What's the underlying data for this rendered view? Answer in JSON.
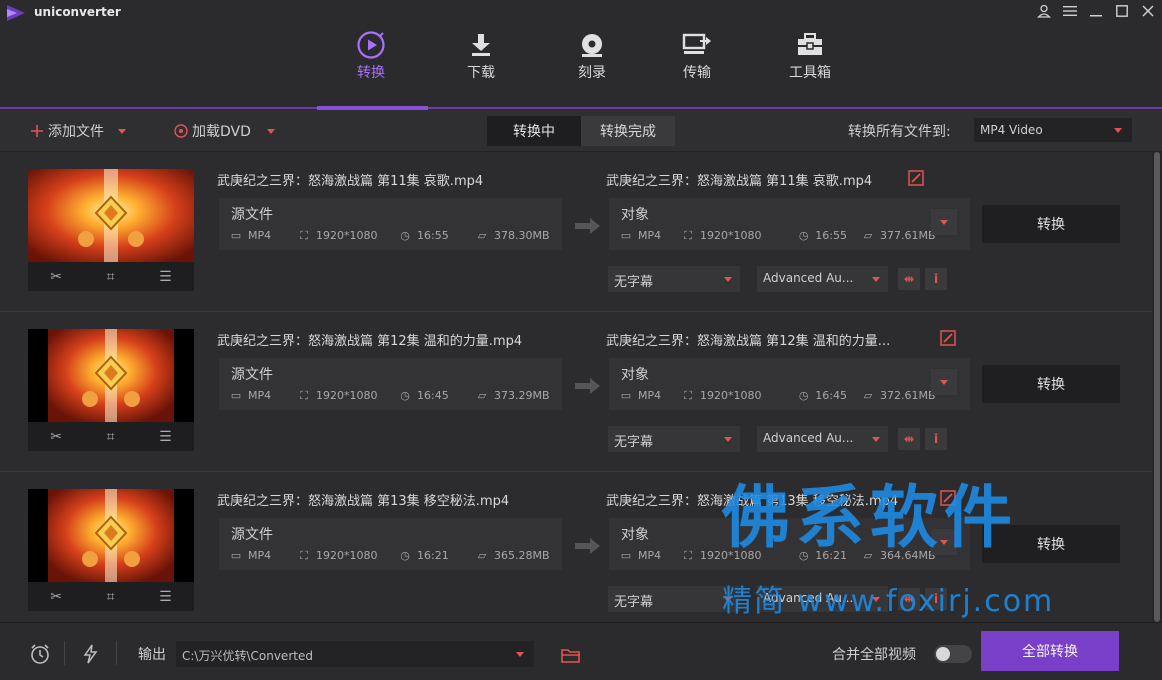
{
  "app": {
    "title": "uniconverter"
  },
  "nav": [
    {
      "label": "转换",
      "icon": "convert-icon",
      "active": true
    },
    {
      "label": "下载",
      "icon": "download-icon",
      "active": false
    },
    {
      "label": "刻录",
      "icon": "burn-disc-icon",
      "active": false
    },
    {
      "label": "传输",
      "icon": "transfer-icon",
      "active": false
    },
    {
      "label": "工具箱",
      "icon": "toolbox-icon",
      "active": false
    }
  ],
  "toolbar": {
    "add_files": "添加文件",
    "load_dvd": "加载DVD",
    "tab_converting": "转换中",
    "tab_finished": "转换完成",
    "convert_all_to_label": "转换所有文件到:",
    "format_value": "MP4 Video"
  },
  "files": [
    {
      "source_name": "武庚纪之三界：怒海激战篇 第11集 哀歌.mp4",
      "target_name": "武庚纪之三界：怒海激战篇 第11集 哀歌.mp4",
      "source_label": "源文件",
      "target_label": "对象",
      "src": {
        "format": "MP4",
        "resolution": "1920*1080",
        "duration": "16:55",
        "size": "378.30MB"
      },
      "dst": {
        "format": "MP4",
        "resolution": "1920*1080",
        "duration": "16:55",
        "size": "377.61MB"
      },
      "subtitle": "无字幕",
      "audio": "Advanced Au...",
      "convert_label": "转换"
    },
    {
      "source_name": "武庚纪之三界：怒海激战篇 第12集 温和的力量.mp4",
      "target_name": "武庚纪之三界：怒海激战篇 第12集 温和的力量...",
      "source_label": "源文件",
      "target_label": "对象",
      "src": {
        "format": "MP4",
        "resolution": "1920*1080",
        "duration": "16:45",
        "size": "373.29MB"
      },
      "dst": {
        "format": "MP4",
        "resolution": "1920*1080",
        "duration": "16:45",
        "size": "372.61MB"
      },
      "subtitle": "无字幕",
      "audio": "Advanced Au...",
      "convert_label": "转换"
    },
    {
      "source_name": "武庚纪之三界：怒海激战篇 第13集 移空秘法.mp4",
      "target_name": "武庚纪之三界：怒海激战篇 第13集 移空秘法.mp4",
      "source_label": "源文件",
      "target_label": "对象",
      "src": {
        "format": "MP4",
        "resolution": "1920*1080",
        "duration": "16:21",
        "size": "365.28MB"
      },
      "dst": {
        "format": "MP4",
        "resolution": "1920*1080",
        "duration": "16:21",
        "size": "364.64MB"
      },
      "subtitle": "无字幕",
      "audio": "Advanced Au...",
      "convert_label": "转换"
    }
  ],
  "bottom": {
    "output_label": "输出",
    "output_path": "C:\\万兴优转\\Converted",
    "merge_label": "合并全部视频",
    "convert_all": "全部转换"
  },
  "watermark": {
    "big": "佛系软件",
    "small": "精简 www.foxirj.com"
  },
  "colors": {
    "accent": "#7a3fc8",
    "red": "#e05454",
    "background": "#2a2a2c"
  }
}
